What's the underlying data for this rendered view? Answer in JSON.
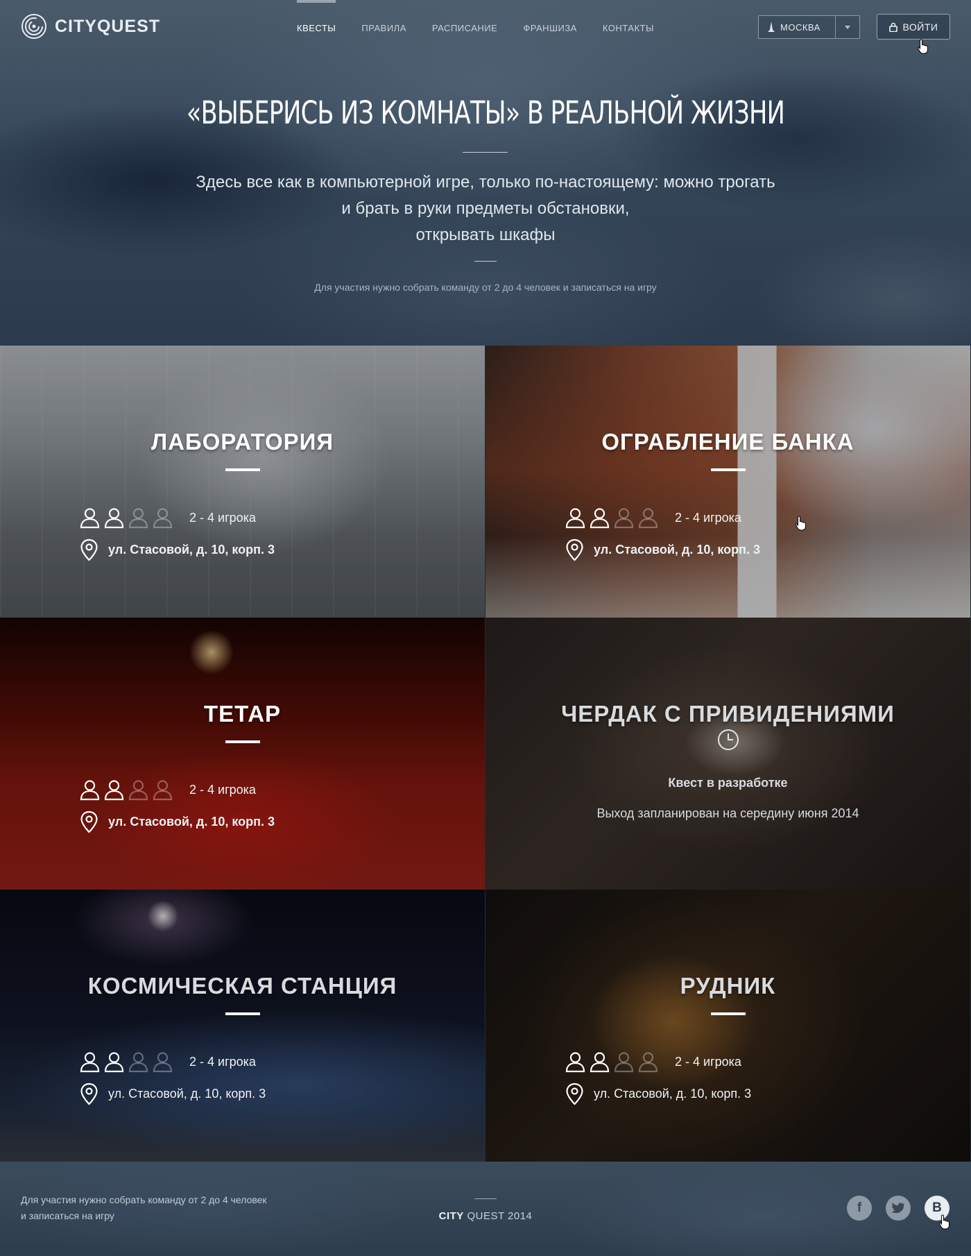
{
  "header": {
    "logo_text": "CITYQUEST",
    "nav": [
      {
        "label": "КВЕСТЫ",
        "active": true
      },
      {
        "label": "ПРАВИЛА",
        "active": false
      },
      {
        "label": "РАСПИСАНИЕ",
        "active": false
      },
      {
        "label": "ФРАНШИЗА",
        "active": false
      },
      {
        "label": "КОНТАКТЫ",
        "active": false
      }
    ],
    "city": "МОСКВА",
    "login_label": "ВОЙТИ"
  },
  "hero": {
    "title": "«ВЫБЕРИСЬ ИЗ КОМНАТЫ» В РЕАЛЬНОЙ ЖИЗНИ",
    "subtitle_lines": [
      "Здесь все как в компьютерной игре, только по-настоящему: можно трогать",
      "и брать в руки предметы обстановки,",
      "открывать шкафы"
    ],
    "note": "Для участия нужно собрать команду от 2 до 4 человек и записаться на игру"
  },
  "quests": [
    {
      "title": "ЛАБОРАТОРИЯ",
      "players": "2 - 4 игрока",
      "address": "ул. Стасовой, д. 10, корп. 3",
      "players_active": 2,
      "players_total": 4
    },
    {
      "title": "ОГРАБЛЕНИЕ БАНКА",
      "players": "2 - 4 игрока",
      "address": "ул. Стасовой, д. 10, корп. 3",
      "players_active": 2,
      "players_total": 4
    },
    {
      "title": "ТЕТАР",
      "players": "2 - 4 игрока",
      "address": "ул. Стасовой, д. 10, корп. 3",
      "players_active": 2,
      "players_total": 4
    },
    {
      "title": "ЧЕРДАК С ПРИВИДЕНИЯМИ",
      "status": "Квест в разработке",
      "note": "Выход запланирован на середину июня 2014"
    },
    {
      "title": "КОСМИЧЕСКАЯ СТАНЦИЯ",
      "players": "2 - 4 игрока",
      "address": "ул. Стасовой, д. 10, корп. 3",
      "players_active": 2,
      "players_total": 4
    },
    {
      "title": "РУДНИК",
      "players": "2 - 4 игрока",
      "address": "ул. Стасовой, д. 10, корп. 3",
      "players_active": 2,
      "players_total": 4
    }
  ],
  "footer": {
    "note_lines": [
      "Для участия нужно собрать команду от 2 до 4 человек",
      "и записаться на игру"
    ],
    "brand_bold": "CITY",
    "brand_rest": " QUEST 2014",
    "social": [
      {
        "name": "facebook-icon",
        "glyph": "f"
      },
      {
        "name": "twitter-icon",
        "glyph": "t"
      },
      {
        "name": "vk-icon",
        "glyph": "В"
      }
    ]
  }
}
